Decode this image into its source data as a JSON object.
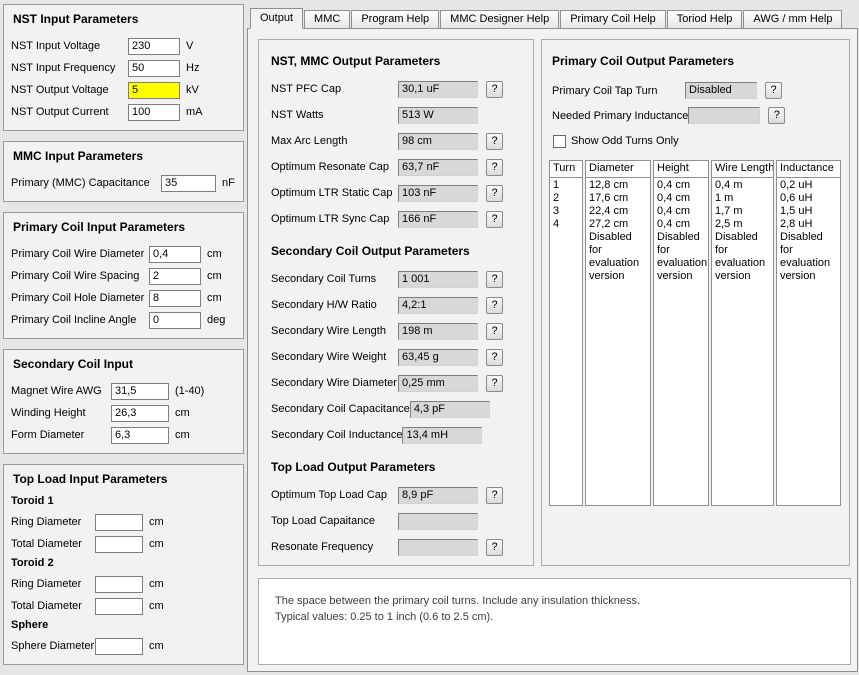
{
  "ui": {
    "help_button_label": "?"
  },
  "colors": {
    "highlight_field": "#FFFF00"
  },
  "tabs": {
    "selected": "Output",
    "items": [
      {
        "label": "Output"
      },
      {
        "label": "MMC"
      },
      {
        "label": "Program Help"
      },
      {
        "label": "MMC Designer Help"
      },
      {
        "label": "Primary Coil Help"
      },
      {
        "label": "Toriod Help"
      },
      {
        "label": "AWG / mm Help"
      }
    ]
  },
  "inputs": {
    "nst": {
      "title": "NST Input Parameters",
      "rows": [
        {
          "label": "NST Input Voltage",
          "value": "230",
          "unit": "V"
        },
        {
          "label": "NST Input Frequency",
          "value": "50",
          "unit": "Hz"
        },
        {
          "label": "NST Output Voltage",
          "value": "5",
          "unit": "kV",
          "highlighted": true
        },
        {
          "label": "NST Output Current",
          "value": "100",
          "unit": "mA"
        }
      ]
    },
    "mmc": {
      "title": "MMC Input Parameters",
      "rows": [
        {
          "label": "Primary (MMC) Capacitance",
          "value": "35",
          "unit": "nF"
        }
      ]
    },
    "primary": {
      "title": "Primary Coil Input Parameters",
      "rows": [
        {
          "label": "Primary Coil Wire Diameter",
          "value": "0,4",
          "unit": "cm"
        },
        {
          "label": "Primary Coil Wire Spacing",
          "value": "2",
          "unit": "cm"
        },
        {
          "label": "Primary Coil Hole Diameter",
          "value": "8",
          "unit": "cm"
        },
        {
          "label": "Primary Coil Incline Angle",
          "value": "0",
          "unit": "deg"
        }
      ]
    },
    "secondary": {
      "title": "Secondary Coil Input",
      "rows": [
        {
          "label": "Magnet Wire AWG",
          "value": "31,5",
          "unit": "(1-40)"
        },
        {
          "label": "Winding Height",
          "value": "26,3",
          "unit": "cm"
        },
        {
          "label": "Form Diameter",
          "value": "6,3",
          "unit": "cm"
        }
      ]
    },
    "topload": {
      "title": "Top Load Input Parameters",
      "groups": [
        {
          "name": "Toroid 1",
          "rows": [
            {
              "label": "Ring Diameter",
              "value": "",
              "unit": "cm"
            },
            {
              "label": "Total Diameter",
              "value": "",
              "unit": "cm"
            }
          ]
        },
        {
          "name": "Toroid 2",
          "rows": [
            {
              "label": "Ring Diameter",
              "value": "",
              "unit": "cm"
            },
            {
              "label": "Total Diameter",
              "value": "",
              "unit": "cm"
            }
          ]
        },
        {
          "name": "Sphere",
          "rows": [
            {
              "label": "Sphere Diameter",
              "value": "",
              "unit": "cm"
            }
          ]
        }
      ]
    }
  },
  "output": {
    "nst_mmc": {
      "title": "NST, MMC Output Parameters",
      "rows": [
        {
          "label": "NST PFC Cap",
          "value": "30,1 uF",
          "help": true
        },
        {
          "label": "NST Watts",
          "value": "513 W",
          "help": false
        },
        {
          "label": "Max Arc Length",
          "value": "98 cm",
          "help": true
        },
        {
          "label": "Optimum Resonate Cap",
          "value": "63,7 nF",
          "help": true
        },
        {
          "label": "Optimum LTR Static Cap",
          "value": "103 nF",
          "help": true
        },
        {
          "label": "Optimum LTR Sync Cap",
          "value": "166 nF",
          "help": true
        }
      ]
    },
    "secondary": {
      "title": "Secondary Coil Output Parameters",
      "rows": [
        {
          "label": "Secondary Coil Turns",
          "value": "1 001",
          "help": true
        },
        {
          "label": "Secondary H/W Ratio",
          "value": "4,2:1",
          "help": true
        },
        {
          "label": "Secondary Wire Length",
          "value": "198 m",
          "help": true
        },
        {
          "label": "Secondary Wire Weight",
          "value": "63,45 g",
          "help": true
        },
        {
          "label": "Secondary Wire Diameter",
          "value": "0,25 mm",
          "help": true
        },
        {
          "label": "Secondary Coil Capacitance",
          "value": "4,3 pF",
          "help": false
        },
        {
          "label": "Secondary Coil Inductance",
          "value": "13,4 mH",
          "help": false
        }
      ]
    },
    "topload": {
      "title": "Top Load Output Parameters",
      "rows": [
        {
          "label": "Optimum Top Load Cap",
          "value": "8,9 pF",
          "help": true
        },
        {
          "label": "Top Load Capaitance",
          "value": "",
          "help": false
        },
        {
          "label": "Resonate Frequency",
          "value": "",
          "help": true
        }
      ]
    }
  },
  "primary_output": {
    "title": "Primary Coil Output Parameters",
    "tap_turn_label": "Primary Coil Tap Turn",
    "tap_turn_value": "Disabled",
    "inductance_label": "Needed Primary Inductance",
    "inductance_value": "",
    "checkbox_label": "Show Odd Turns Only",
    "checkbox_checked": false,
    "table": {
      "headers": [
        "Turn",
        "Diameter",
        "Height",
        "Wire Length",
        "Inductance"
      ],
      "rows": [
        [
          "1",
          "12,8 cm",
          "0,4 cm",
          "0,4 m",
          "0,2 uH"
        ],
        [
          "2",
          "17,6 cm",
          "0,4 cm",
          "1 m",
          "0,6 uH"
        ],
        [
          "3",
          "22,4 cm",
          "0,4 cm",
          "1,7 m",
          "1,5 uH"
        ],
        [
          "4",
          "27,2 cm",
          "0,4 cm",
          "2,5 m",
          "2,8 uH"
        ]
      ],
      "disabled_note": "Disabled for evaluation version"
    }
  },
  "footer_help": {
    "line1": "The space between the primary coil turns. Include any insulation thickness.",
    "line2": "Typical values: 0.25 to 1 inch (0.6 to 2.5 cm)."
  }
}
